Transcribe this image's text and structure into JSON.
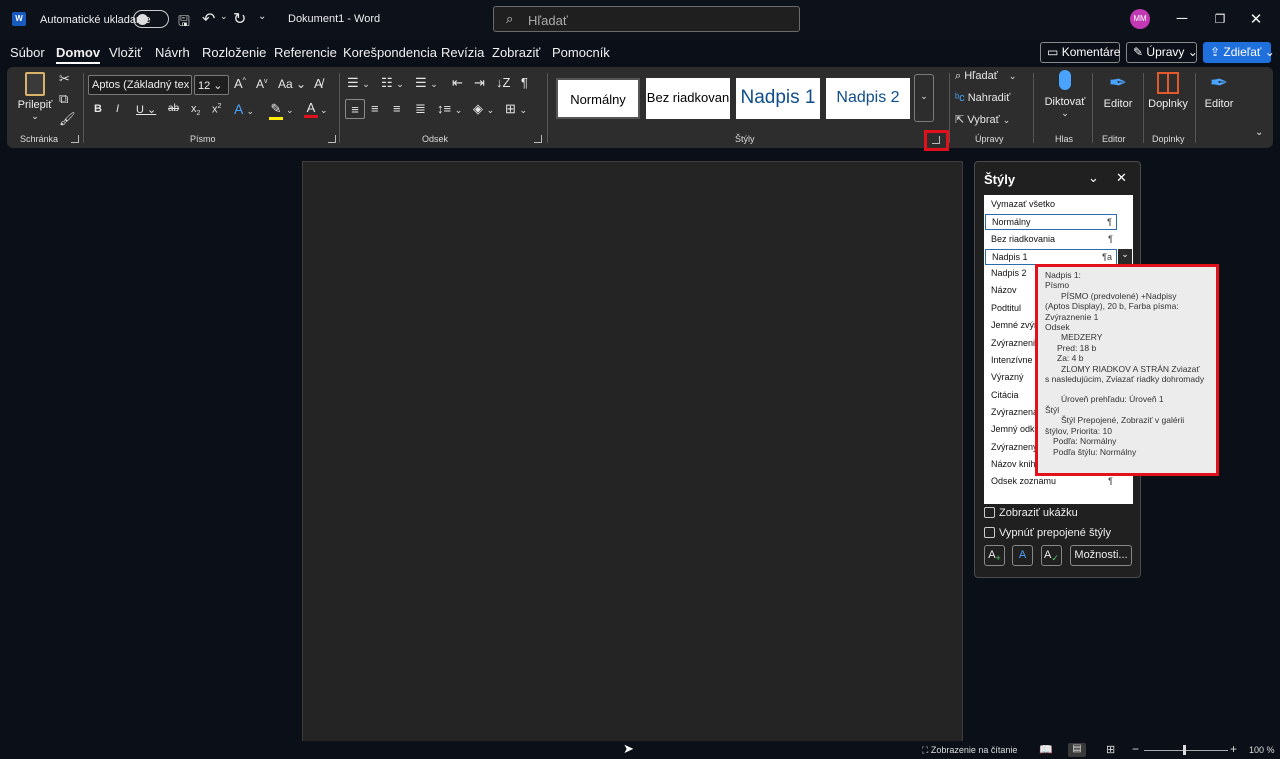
{
  "titlebar": {
    "autosave_label": "Automatické ukladanie",
    "doc_title": "Dokument1 - Word",
    "search_placeholder": "Hľadať",
    "avatar_initials": "MM"
  },
  "menu": {
    "items": [
      "Súbor",
      "Domov",
      "Vložiť",
      "Návrh",
      "Rozloženie",
      "Referencie",
      "Korešpondencia",
      "Revízia",
      "Zobraziť",
      "Pomocník"
    ],
    "active": "Domov",
    "comments_label": "Komentáre",
    "edit_label": "Úpravy",
    "share_label": "Zdieľať"
  },
  "ribbon": {
    "clipboard": {
      "paste_label": "Prilepiť",
      "group_label": "Schránka"
    },
    "font": {
      "font_name": "Aptos (Základný tex",
      "font_size": "12",
      "group_label": "Písmo",
      "case_label": "Aa"
    },
    "paragraph": {
      "group_label": "Odsek"
    },
    "styles": {
      "items": [
        "Normálny",
        "Bez riadkovan",
        "Nadpis 1",
        "Nadpis 2"
      ],
      "group_label": "Štýly"
    },
    "editing": {
      "find_label": "Hľadať",
      "replace_label": "Nahradiť",
      "select_label": "Vybrať",
      "group_label": "Úpravy"
    },
    "voice": {
      "dictate_label": "Diktovať",
      "group_label": "Hlas"
    },
    "editor": {
      "label": "Editor",
      "group_label": "Editor"
    },
    "addins": {
      "label": "Doplnky",
      "group_label": "Doplnky"
    },
    "editor2": {
      "label": "Editor"
    }
  },
  "styles_pane": {
    "title": "Štýly",
    "items": [
      {
        "label": "Vymazať všetko",
        "mark": ""
      },
      {
        "label": "Normálny",
        "mark": "¶"
      },
      {
        "label": "Bez riadkovania",
        "mark": "¶"
      },
      {
        "label": "Nadpis 1",
        "mark": "¶a"
      },
      {
        "label": "Nadpis 2",
        "mark": ""
      },
      {
        "label": "Názov",
        "mark": ""
      },
      {
        "label": "Podtitul",
        "mark": ""
      },
      {
        "label": "Jemné zvýr",
        "mark": ""
      },
      {
        "label": "Zvýraznenie",
        "mark": ""
      },
      {
        "label": "Intenzívne z",
        "mark": ""
      },
      {
        "label": "Výrazný",
        "mark": ""
      },
      {
        "label": "Citácia",
        "mark": ""
      },
      {
        "label": "Zvýraznená",
        "mark": ""
      },
      {
        "label": "Jemný odk",
        "mark": ""
      },
      {
        "label": "Zvýraznený",
        "mark": ""
      },
      {
        "label": "Názov knih",
        "mark": ""
      },
      {
        "label": "Odsek zoznamu",
        "mark": "¶"
      }
    ],
    "show_preview_label": "Zobraziť ukážku",
    "disable_linked_label": "Vypnúť prepojené štýly",
    "options_label": "Možnosti..."
  },
  "tooltip": {
    "lines": [
      "Nadpis 1:",
      "Písmo",
      "        PÍSMO  (predvolené) +Nadpisy",
      "(Aptos Display), 20 b, Farba písma:",
      "Zvýraznenie 1",
      "Odsek",
      "        MEDZERY",
      "      Pred:  18 b",
      "      Za:  4 b",
      "        ZLOMY RIADKOV A STRÁN  Zviazať",
      "s nasledujúcim, Zviazať riadky dohromady",
      "",
      "        Úroveň prehľadu:  Úroveň 1",
      "Štýl",
      "        Štýl Prepojené, Zobraziť v galérii",
      "štýlov, Priorita: 10",
      "    Podľa: Normálny",
      "    Podľa štýlu: Normálny"
    ]
  },
  "statusbar": {
    "reading_mode": "Zobrazenie na čítanie",
    "zoom": "100 %"
  },
  "colors": {
    "highlight_red": "#e1101a",
    "accent_blue": "#1f6fdc",
    "avatar": "#c239b3"
  }
}
